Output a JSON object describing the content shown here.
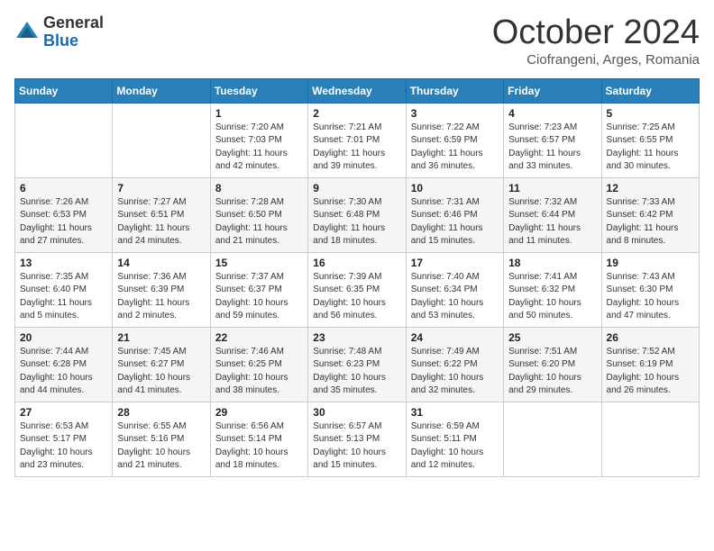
{
  "header": {
    "logo_general": "General",
    "logo_blue": "Blue",
    "month_title": "October 2024",
    "location": "Ciofrangeni, Arges, Romania"
  },
  "days_of_week": [
    "Sunday",
    "Monday",
    "Tuesday",
    "Wednesday",
    "Thursday",
    "Friday",
    "Saturday"
  ],
  "weeks": [
    [
      {
        "day": "",
        "info": ""
      },
      {
        "day": "",
        "info": ""
      },
      {
        "day": "1",
        "info": "Sunrise: 7:20 AM\nSunset: 7:03 PM\nDaylight: 11 hours and 42 minutes."
      },
      {
        "day": "2",
        "info": "Sunrise: 7:21 AM\nSunset: 7:01 PM\nDaylight: 11 hours and 39 minutes."
      },
      {
        "day": "3",
        "info": "Sunrise: 7:22 AM\nSunset: 6:59 PM\nDaylight: 11 hours and 36 minutes."
      },
      {
        "day": "4",
        "info": "Sunrise: 7:23 AM\nSunset: 6:57 PM\nDaylight: 11 hours and 33 minutes."
      },
      {
        "day": "5",
        "info": "Sunrise: 7:25 AM\nSunset: 6:55 PM\nDaylight: 11 hours and 30 minutes."
      }
    ],
    [
      {
        "day": "6",
        "info": "Sunrise: 7:26 AM\nSunset: 6:53 PM\nDaylight: 11 hours and 27 minutes."
      },
      {
        "day": "7",
        "info": "Sunrise: 7:27 AM\nSunset: 6:51 PM\nDaylight: 11 hours and 24 minutes."
      },
      {
        "day": "8",
        "info": "Sunrise: 7:28 AM\nSunset: 6:50 PM\nDaylight: 11 hours and 21 minutes."
      },
      {
        "day": "9",
        "info": "Sunrise: 7:30 AM\nSunset: 6:48 PM\nDaylight: 11 hours and 18 minutes."
      },
      {
        "day": "10",
        "info": "Sunrise: 7:31 AM\nSunset: 6:46 PM\nDaylight: 11 hours and 15 minutes."
      },
      {
        "day": "11",
        "info": "Sunrise: 7:32 AM\nSunset: 6:44 PM\nDaylight: 11 hours and 11 minutes."
      },
      {
        "day": "12",
        "info": "Sunrise: 7:33 AM\nSunset: 6:42 PM\nDaylight: 11 hours and 8 minutes."
      }
    ],
    [
      {
        "day": "13",
        "info": "Sunrise: 7:35 AM\nSunset: 6:40 PM\nDaylight: 11 hours and 5 minutes."
      },
      {
        "day": "14",
        "info": "Sunrise: 7:36 AM\nSunset: 6:39 PM\nDaylight: 11 hours and 2 minutes."
      },
      {
        "day": "15",
        "info": "Sunrise: 7:37 AM\nSunset: 6:37 PM\nDaylight: 10 hours and 59 minutes."
      },
      {
        "day": "16",
        "info": "Sunrise: 7:39 AM\nSunset: 6:35 PM\nDaylight: 10 hours and 56 minutes."
      },
      {
        "day": "17",
        "info": "Sunrise: 7:40 AM\nSunset: 6:34 PM\nDaylight: 10 hours and 53 minutes."
      },
      {
        "day": "18",
        "info": "Sunrise: 7:41 AM\nSunset: 6:32 PM\nDaylight: 10 hours and 50 minutes."
      },
      {
        "day": "19",
        "info": "Sunrise: 7:43 AM\nSunset: 6:30 PM\nDaylight: 10 hours and 47 minutes."
      }
    ],
    [
      {
        "day": "20",
        "info": "Sunrise: 7:44 AM\nSunset: 6:28 PM\nDaylight: 10 hours and 44 minutes."
      },
      {
        "day": "21",
        "info": "Sunrise: 7:45 AM\nSunset: 6:27 PM\nDaylight: 10 hours and 41 minutes."
      },
      {
        "day": "22",
        "info": "Sunrise: 7:46 AM\nSunset: 6:25 PM\nDaylight: 10 hours and 38 minutes."
      },
      {
        "day": "23",
        "info": "Sunrise: 7:48 AM\nSunset: 6:23 PM\nDaylight: 10 hours and 35 minutes."
      },
      {
        "day": "24",
        "info": "Sunrise: 7:49 AM\nSunset: 6:22 PM\nDaylight: 10 hours and 32 minutes."
      },
      {
        "day": "25",
        "info": "Sunrise: 7:51 AM\nSunset: 6:20 PM\nDaylight: 10 hours and 29 minutes."
      },
      {
        "day": "26",
        "info": "Sunrise: 7:52 AM\nSunset: 6:19 PM\nDaylight: 10 hours and 26 minutes."
      }
    ],
    [
      {
        "day": "27",
        "info": "Sunrise: 6:53 AM\nSunset: 5:17 PM\nDaylight: 10 hours and 23 minutes."
      },
      {
        "day": "28",
        "info": "Sunrise: 6:55 AM\nSunset: 5:16 PM\nDaylight: 10 hours and 21 minutes."
      },
      {
        "day": "29",
        "info": "Sunrise: 6:56 AM\nSunset: 5:14 PM\nDaylight: 10 hours and 18 minutes."
      },
      {
        "day": "30",
        "info": "Sunrise: 6:57 AM\nSunset: 5:13 PM\nDaylight: 10 hours and 15 minutes."
      },
      {
        "day": "31",
        "info": "Sunrise: 6:59 AM\nSunset: 5:11 PM\nDaylight: 10 hours and 12 minutes."
      },
      {
        "day": "",
        "info": ""
      },
      {
        "day": "",
        "info": ""
      }
    ]
  ]
}
